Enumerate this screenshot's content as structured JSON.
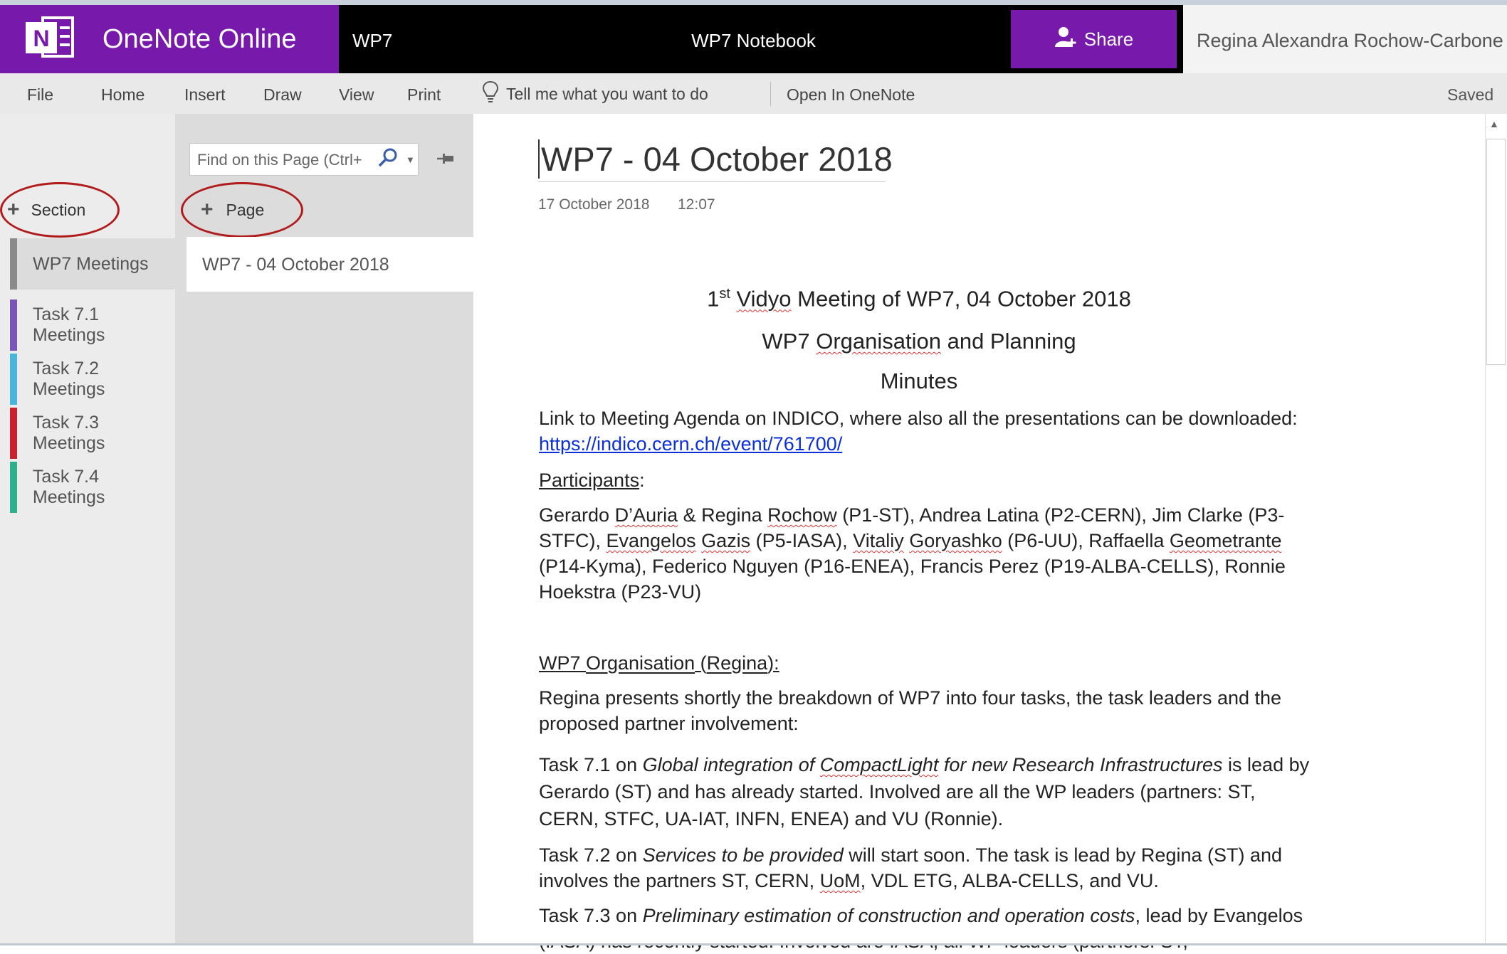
{
  "titlebar": {
    "app_name": "OneNote Online",
    "notebook_short": "WP7",
    "notebook_title": "WP7 Notebook",
    "share_label": "Share",
    "user_name": "Regina Alexandra Rochow-Carbone",
    "brand_color": "#7719aa"
  },
  "ribbon": {
    "tabs": [
      "File",
      "Home",
      "Insert",
      "Draw",
      "View",
      "Print"
    ],
    "tell_me": "Tell me what you want to do",
    "open_in_onenote": "Open In OneNote",
    "status": "Saved"
  },
  "sections": {
    "add_label": "Section",
    "items": [
      {
        "label": "WP7 Meetings",
        "color": "#8a8a8a",
        "active": true
      },
      {
        "label": "Task 7.1 Meetings",
        "color": "#7a55b8"
      },
      {
        "label": "Task 7.2 Meetings",
        "color": "#47b6d9"
      },
      {
        "label": "Task 7.3 Meetings",
        "color": "#c8232c"
      },
      {
        "label": "Task 7.4 Meetings",
        "color": "#2fb08c"
      }
    ]
  },
  "pages": {
    "search_placeholder": "Find on this Page (Ctrl+",
    "add_label": "Page",
    "items": [
      "WP7 - 04 October 2018"
    ]
  },
  "content": {
    "title": "WP7 - 04 October 2018",
    "date": "17 October 2018",
    "time": "12:07",
    "heading1_sup": "st",
    "heading1_rest_a": " ",
    "heading1_vidyo": "Vidyo",
    "heading1_rest_b": " Meeting of WP7, 04 October 2018",
    "heading1_num": "1",
    "heading2_a": "WP7 ",
    "heading2_b": "Organisation",
    "heading2_c": " and Planning",
    "heading3": "Minutes",
    "agenda_text": "Link to Meeting Agenda on INDICO, where also all the presentations can be downloaded: ",
    "agenda_link": "https://indico.cern.ch/event/761700/",
    "participants_label": "Participants",
    "participants_colon": ":",
    "p_1": "Gerardo ",
    "p_dauria": "D’Auria",
    "p_2": " & Regina ",
    "p_rochow": "Rochow",
    "p_3": " (P1-ST), Andrea Latina (P2-CERN), Jim Clarke (P3-STFC), ",
    "p_evangelos": "Evangelos",
    "p_sp1": " ",
    "p_gazis": "Gazis",
    "p_4": " (P5-IASA), ",
    "p_vitaliy": "Vitaliy",
    "p_sp2": " ",
    "p_goryashko": "Goryashko",
    "p_5": " (P6-UU), Raffaella ",
    "p_geometrante": "Geometrante",
    "p_6": " (P14-Kyma), Federico Nguyen (P16-ENEA), Francis Perez (P19-ALBA-CELLS), Ronnie Hoekstra (P23-VU)",
    "org_a": "WP7 ",
    "org_b": "Organisation",
    "org_c": " (",
    "org_d": "Regina",
    "org_e": "):",
    "org_text": "Regina presents shortly the breakdown of WP7 into four tasks, the task leaders and the proposed partner involvement:",
    "t71_a": "Task 7.1 on  ",
    "t71_i1": "Global integration of ",
    "t71_cl": "CompactLight",
    "t71_i2": " for new Research Infrastructures",
    "t71_b": " is lead by Gerardo (ST) and has already started. Involved are all the WP leaders (partners: ST, CERN, STFC, UA-IAT, INFN, ENEA) and VU (Ronnie).",
    "t72_a": "Task 7.2 on ",
    "t72_i": "Services to be provided",
    "t72_b": " will start soon. The task is lead by Regina (ST) and involves the partners ST, CERN, ",
    "t72_uom": "UoM",
    "t72_c": ", VDL ETG, ALBA-CELLS, and VU.",
    "t73_a": "Task 7.3 on ",
    "t73_i": "Preliminary estimation of construction and operation costs",
    "t73_b": ", lead by Evangelos (IASA) has recently started. Involved are IASA, all WP leaders (partners: ST,"
  }
}
